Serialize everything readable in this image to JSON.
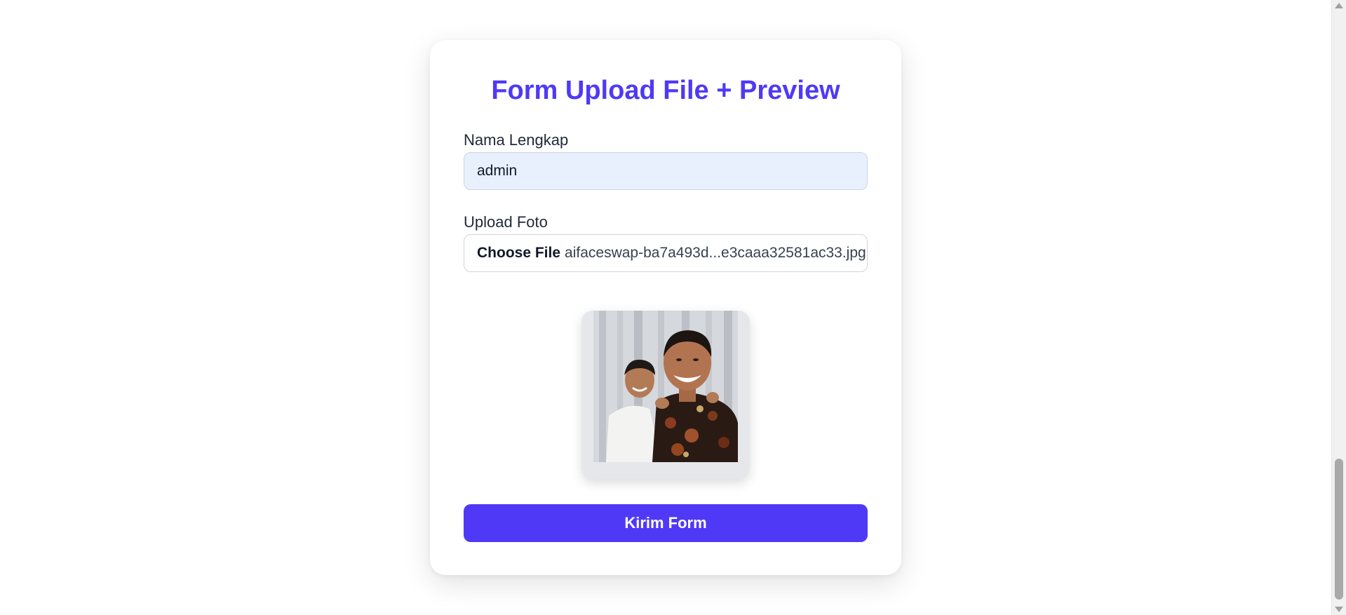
{
  "form": {
    "title": "Form Upload File + Preview",
    "name_label": "Nama Lengkap",
    "name_value": "admin",
    "file_label": "Upload Foto",
    "choose_file_label": "Choose File",
    "file_name": "aifaceswap-ba7a493d...e3caaa32581ac33.jpg",
    "submit_label": "Kirim Form"
  },
  "colors": {
    "accent": "#4f39f6",
    "input_autofill_bg": "#e8f0fe"
  },
  "scroll": {
    "position_fraction": 0.78
  }
}
